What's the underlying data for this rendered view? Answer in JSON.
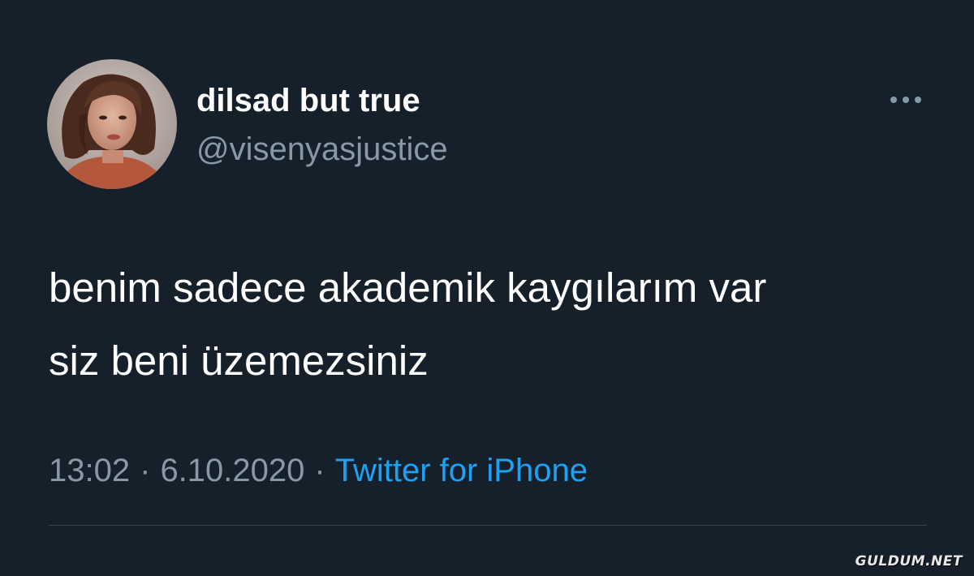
{
  "tweet": {
    "display_name": "dilsad but true",
    "handle": "@visenyasjustice",
    "text_lines": [
      "benim sadece akademik kaygılarım var",
      "siz beni üzemezsiniz"
    ],
    "time": "13:02",
    "date": "6.10.2020",
    "separator": "·",
    "source": "Twitter for iPhone"
  },
  "watermark": "GULDUM.NET",
  "icons": {
    "more": "more-horizontal-icon",
    "avatar": "profile-photo"
  },
  "colors": {
    "background": "#15202b",
    "primary_text": "#ffffff",
    "secondary_text": "#8899a6",
    "link": "#1da1f2",
    "divider": "#38444d"
  }
}
